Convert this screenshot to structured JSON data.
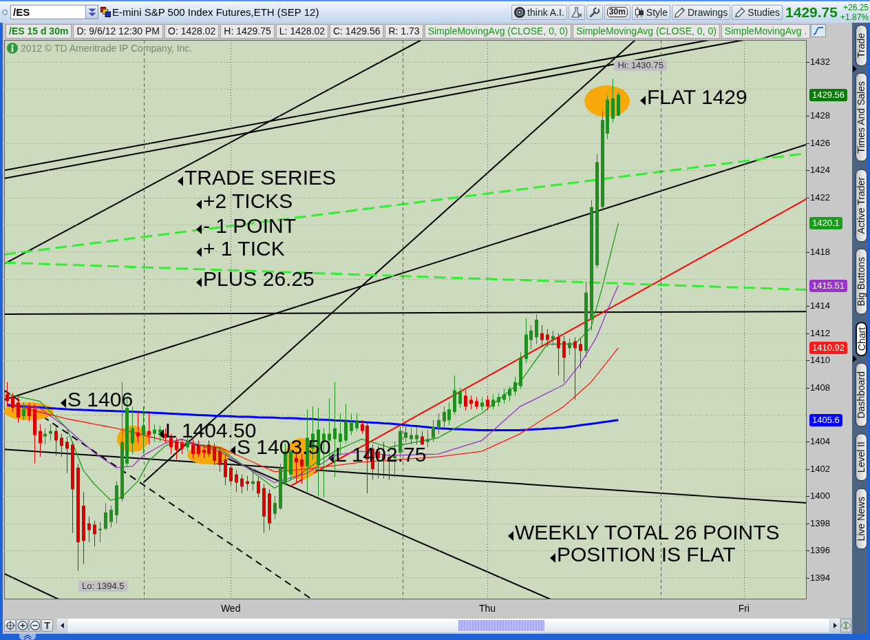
{
  "toolbar": {
    "symbol_field": {
      "value": "/ES"
    },
    "title": "E-mini S&P 500 Index Futures,ETH (SEP 12)",
    "buttons": [
      {
        "kind": "think",
        "label": "think A.I."
      },
      {
        "kind": "flask"
      },
      {
        "kind": "wrench"
      },
      {
        "kind": "interval",
        "label": "30m"
      },
      {
        "kind": "style",
        "label": "Style"
      },
      {
        "kind": "drawings",
        "label": "Drawings"
      },
      {
        "kind": "studies",
        "label": "Studies"
      }
    ],
    "last_price": "1429.75",
    "net_change": "+26.25",
    "percent_change": "+1.87%"
  },
  "legend": [
    {
      "kind": "symbol",
      "text": "/ES 15 d 30m"
    },
    {
      "kind": "readout",
      "text": "D: 9/6/12 12:30 PM"
    },
    {
      "kind": "readout",
      "text": "O: 1428.02"
    },
    {
      "kind": "readout",
      "text": "H: 1429.75"
    },
    {
      "kind": "readout",
      "text": "L: 1428.02"
    },
    {
      "kind": "readout",
      "text": "C: 1429.56"
    },
    {
      "kind": "readout",
      "text": "R: 1.73"
    },
    {
      "kind": "study",
      "text": "SimpleMovingAvg (CLOSE, 0, 0)"
    },
    {
      "kind": "study",
      "text": "SimpleMovingAvg (CLOSE, 0, 0)"
    },
    {
      "kind": "study",
      "text": "SimpleMovingAvg ."
    }
  ],
  "copyright": "2012 © TD Ameritrade IP Company, Inc.",
  "chart": {
    "chart_data": {
      "type": "candlestick",
      "categories": [
        null,
        null,
        null,
        null,
        null,
        null,
        null,
        null,
        null,
        null,
        null,
        null,
        null,
        null,
        null,
        null,
        null,
        null,
        null,
        null,
        null,
        null,
        null,
        null,
        null,
        null,
        null,
        null,
        null,
        null,
        null,
        null,
        null,
        null,
        null,
        null,
        null,
        null,
        null,
        null,
        null,
        "Wed",
        null,
        null,
        null,
        null,
        null,
        null,
        null,
        null,
        null,
        null,
        null,
        null,
        null,
        null,
        null,
        null,
        null,
        null,
        null,
        null,
        null,
        null,
        null,
        null,
        null,
        null,
        null,
        null,
        null,
        null,
        null,
        null,
        null,
        null,
        null,
        null,
        null,
        null,
        null,
        null,
        null,
        null,
        null,
        null,
        null,
        null,
        "Thu",
        null,
        null,
        null,
        null,
        null,
        null,
        null,
        null,
        null,
        null,
        null,
        null,
        null,
        null,
        null,
        null,
        null,
        null,
        null,
        null,
        null,
        null,
        null,
        null,
        null,
        null,
        null,
        null,
        null,
        null,
        null,
        null,
        null,
        null,
        null,
        null,
        null,
        null,
        null,
        null,
        null,
        null,
        null,
        null,
        null,
        null,
        "Fri",
        null,
        null,
        null,
        null,
        null,
        null,
        null,
        null,
        null,
        null,
        null
      ],
      "ohlc": [
        [
          1407.5,
          1408.4,
          1406.6,
          1407.0
        ],
        [
          1407.3,
          1407.6,
          1406.2,
          1406.5
        ],
        [
          1406.9,
          1407.3,
          1405.4,
          1405.8
        ],
        [
          1405.9,
          1406.9,
          1405.6,
          1406.4
        ],
        [
          1406.5,
          1406.9,
          1405.5,
          1405.9
        ],
        [
          1406.4,
          1406.8,
          1402.4,
          1404.5
        ],
        [
          1404.8,
          1405.3,
          1402.9,
          1403.9
        ],
        [
          1404.4,
          1405.0,
          1403.8,
          1404.6
        ],
        [
          1404.6,
          1405.3,
          1404.1,
          1404.8
        ],
        [
          1404.8,
          1405.1,
          1403.0,
          1404.1
        ],
        [
          1404.3,
          1404.6,
          1402.9,
          1403.7
        ],
        [
          1404.0,
          1404.4,
          1401.7,
          1403.5
        ],
        [
          1403.8,
          1404.0,
          1397.3,
          1400.5
        ],
        [
          1402.1,
          1402.4,
          1394.5,
          1396.6
        ],
        [
          1399.3,
          1400.3,
          1395.0,
          1396.7
        ],
        [
          1398.0,
          1398.5,
          1396.6,
          1397.5
        ],
        [
          1397.9,
          1398.2,
          1396.3,
          1397.2
        ],
        [
          1397.5,
          1398.1,
          1396.6,
          1397.6
        ],
        [
          1397.6,
          1399.5,
          1397.5,
          1398.8
        ],
        [
          1398.1,
          1399.3,
          1397.7,
          1399.0
        ],
        [
          1398.6,
          1401.1,
          1398.0,
          1400.8
        ],
        [
          1399.8,
          1408.4,
          1399.6,
          1404.0
        ],
        [
          1402.4,
          1407.3,
          1402.2,
          1406.5
        ],
        [
          1403.9,
          1406.6,
          1403.1,
          1405.0
        ],
        [
          1404.7,
          1406.2,
          1403.9,
          1404.4
        ],
        [
          1404.5,
          1406.6,
          1403.1,
          1405.2
        ],
        [
          1404.8,
          1406.1,
          1403.8,
          1404.5
        ],
        [
          1404.6,
          1405.3,
          1404.0,
          1404.9
        ],
        [
          1404.7,
          1405.2,
          1404.0,
          1404.9
        ],
        [
          1404.6,
          1405.0,
          1403.9,
          1404.3
        ],
        [
          1404.3,
          1404.6,
          1403.1,
          1403.6
        ],
        [
          1404.0,
          1404.3,
          1402.7,
          1403.4
        ],
        [
          1403.9,
          1404.2,
          1403.1,
          1403.5
        ],
        [
          1403.6,
          1404.4,
          1403.3,
          1404.0
        ],
        [
          1403.8,
          1404.2,
          1402.8,
          1403.1
        ],
        [
          1403.7,
          1404.1,
          1402.9,
          1403.1
        ],
        [
          1403.4,
          1403.8,
          1402.8,
          1403.2
        ],
        [
          1403.8,
          1404.1,
          1402.9,
          1403.1
        ],
        [
          1403.6,
          1403.9,
          1402.3,
          1402.6
        ],
        [
          1403.3,
          1403.6,
          1401.8,
          1402.3
        ],
        [
          1402.7,
          1403.0,
          1400.8,
          1401.4
        ],
        [
          1402.1,
          1402.4,
          1400.8,
          1401.1
        ],
        [
          1401.6,
          1401.9,
          1400.3,
          1401.0
        ],
        [
          1401.3,
          1401.6,
          1400.2,
          1400.7
        ],
        [
          1401.1,
          1401.5,
          1400.4,
          1400.9
        ],
        [
          1400.9,
          1402.0,
          1400.4,
          1401.1
        ],
        [
          1401.1,
          1401.4,
          1399.9,
          1400.2
        ],
        [
          1400.6,
          1400.9,
          1397.3,
          1398.5
        ],
        [
          1400.2,
          1400.5,
          1397.5,
          1398.0
        ],
        [
          1398.7,
          1400.0,
          1398.3,
          1399.5
        ],
        [
          1399.1,
          1402.4,
          1399.0,
          1402.1
        ],
        [
          1401.0,
          1403.9,
          1400.8,
          1403.3
        ],
        [
          1401.6,
          1403.4,
          1401.2,
          1403.3
        ],
        [
          1402.8,
          1403.3,
          1401.0,
          1402.5
        ],
        [
          1402.7,
          1403.1,
          1400.9,
          1402.2
        ],
        [
          1402.2,
          1406.4,
          1400.3,
          1404.3
        ],
        [
          1403.5,
          1406.6,
          1402.7,
          1404.6
        ],
        [
          1402.3,
          1406.5,
          1400.0,
          1404.9
        ],
        [
          1404.0,
          1405.0,
          1399.9,
          1404.6
        ],
        [
          1404.1,
          1407.2,
          1402.9,
          1404.6
        ],
        [
          1404.2,
          1408.4,
          1401.4,
          1405.0
        ],
        [
          1404.0,
          1406.1,
          1403.1,
          1404.6
        ],
        [
          1404.1,
          1406.8,
          1403.9,
          1405.5
        ],
        [
          1404.8,
          1406.1,
          1404.5,
          1405.4
        ],
        [
          1405.0,
          1406.1,
          1404.8,
          1405.5
        ],
        [
          1405.3,
          1405.6,
          1404.6,
          1404.8
        ],
        [
          1405.2,
          1405.4,
          1400.2,
          1402.7
        ],
        [
          1403.5,
          1403.8,
          1401.2,
          1402.0
        ],
        [
          1403.3,
          1403.7,
          1401.3,
          1402.8
        ],
        [
          1403.1,
          1404.0,
          1401.3,
          1402.7
        ],
        [
          1402.9,
          1403.1,
          1401.2,
          1402.7
        ],
        [
          1402.8,
          1404.0,
          1401.4,
          1403.0
        ],
        [
          1403.2,
          1405.3,
          1402.8,
          1404.8
        ],
        [
          1404.3,
          1405.4,
          1404.0,
          1404.7
        ],
        [
          1404.2,
          1405.0,
          1403.8,
          1404.5
        ],
        [
          1404.2,
          1405.1,
          1403.8,
          1404.5
        ],
        [
          1404.4,
          1404.8,
          1403.75,
          1403.8
        ],
        [
          1404.0,
          1404.9,
          1403.6,
          1404.2
        ],
        [
          1404.3,
          1405.6,
          1404.0,
          1405.1
        ],
        [
          1405.0,
          1406.1,
          1404.6,
          1405.6
        ],
        [
          1405.5,
          1406.6,
          1405.1,
          1406.2
        ],
        [
          1405.6,
          1406.9,
          1405.2,
          1406.4
        ],
        [
          1406.2,
          1408.9,
          1406.0,
          1407.8
        ],
        [
          1406.8,
          1408.0,
          1406.5,
          1407.7
        ],
        [
          1407.4,
          1407.8,
          1406.3,
          1406.6
        ],
        [
          1407.1,
          1407.4,
          1406.4,
          1406.8
        ],
        [
          1407.0,
          1407.3,
          1406.4,
          1406.6
        ],
        [
          1406.6,
          1407.3,
          1406.3,
          1406.9
        ],
        [
          1407.1,
          1407.4,
          1406.3,
          1406.6
        ],
        [
          1406.6,
          1407.5,
          1406.4,
          1407.1
        ],
        [
          1406.9,
          1407.6,
          1406.6,
          1407.3
        ],
        [
          1407.1,
          1407.9,
          1406.8,
          1407.5
        ],
        [
          1407.4,
          1408.1,
          1407.0,
          1407.9
        ],
        [
          1407.7,
          1408.8,
          1407.4,
          1408.4
        ],
        [
          1408.1,
          1410.6,
          1407.9,
          1410.2
        ],
        [
          1410.1,
          1413.1,
          1409.8,
          1411.9
        ],
        [
          1411.5,
          1412.6,
          1410.8,
          1412.2
        ],
        [
          1411.7,
          1413.4,
          1411.2,
          1413.0
        ],
        [
          1412.0,
          1412.6,
          1411.0,
          1411.5
        ],
        [
          1411.9,
          1412.3,
          1411.0,
          1411.5
        ],
        [
          1411.5,
          1412.2,
          1411.1,
          1411.8
        ],
        [
          1411.7,
          1412.0,
          1408.9,
          1410.9
        ],
        [
          1411.4,
          1411.8,
          1408.4,
          1410.2
        ],
        [
          1410.9,
          1411.6,
          1410.4,
          1411.3
        ],
        [
          1411.4,
          1411.7,
          1407.1,
          1410.9
        ],
        [
          1411.2,
          1411.6,
          1409.4,
          1410.7
        ],
        [
          1410.7,
          1415.8,
          1410.2,
          1415.0
        ],
        [
          1413.0,
          1421.8,
          1412.2,
          1421.3
        ],
        [
          1417.0,
          1425.2,
          1416.8,
          1424.6
        ],
        [
          1421.3,
          1428.4,
          1421.0,
          1427.7
        ],
        [
          1426.7,
          1429.5,
          1426.3,
          1429.2
        ],
        [
          1427.8,
          1430.75,
          1427.5,
          1429.3
        ],
        [
          1428.02,
          1429.75,
          1428.02,
          1429.56
        ],
        null,
        null,
        null,
        null,
        null,
        null,
        null,
        null,
        null,
        null,
        null,
        null,
        null,
        null,
        null,
        null,
        null,
        null,
        null,
        null,
        null,
        null,
        null,
        null,
        null,
        null,
        null,
        null,
        null,
        null,
        null,
        null,
        null,
        null
      ],
      "ylim": [
        1392.4,
        1433.6
      ],
      "yticks": [
        1394,
        1396,
        1398,
        1400,
        1402,
        1404,
        1408,
        1410,
        1412,
        1414,
        1418,
        1422,
        1424,
        1426,
        1428,
        1432
      ],
      "grid": true,
      "series": [
        {
          "type": "line",
          "color": "#1c9c1c",
          "values": [
            1407.5,
            1407.42,
            1407.33,
            1407.25,
            1407.17,
            1407.08,
            1407.0,
            1406.6,
            1406.2,
            1405.8,
            1405.4,
            1405.0,
            1403.97,
            1402.93,
            1401.9,
            1401.4,
            1400.9,
            1400.5,
            1400.1,
            1399.7,
            1399.8,
            1399.9,
            1400.3,
            1400.7,
            1401.1,
            1401.85,
            1402.6,
            1402.97,
            1403.33,
            1403.7,
            1403.87,
            1404.03,
            1404.2,
            1404.05,
            1403.9,
            1403.82,
            1403.74,
            1403.66,
            1403.58,
            1403.5,
            1403.22,
            1402.94,
            1402.66,
            1402.38,
            1402.1,
            1401.8,
            1401.5,
            1401.2,
            1400.9,
            1400.6,
            1400.8,
            1401.0,
            1401.2,
            1401.4,
            1401.7,
            1402.0,
            1402.3,
            1402.55,
            1402.8,
            1403.05,
            1403.3,
            1403.48,
            1403.66,
            1403.84,
            1404.02,
            1404.2,
            1404.08,
            1403.96,
            1403.84,
            1403.72,
            1403.6,
            1403.68,
            1403.76,
            1403.83,
            1403.91,
            1403.99,
            1404.07,
            1404.14,
            1404.22,
            1404.3,
            1404.53,
            1404.75,
            1404.98,
            1405.2,
            1405.43,
            1405.65,
            1405.88,
            1406.1,
            1406.43,
            1406.76,
            1407.09,
            1407.41,
            1407.74,
            1408.07,
            1408.4,
            1408.96,
            1409.52,
            1410.08,
            1410.64,
            1411.2,
            1411.2,
            1411.2,
            1411.2,
            1411.2,
            1411.2,
            1411.6,
            1412.0,
            1412.4,
            1413.85,
            1415.3,
            1416.9,
            1418.5,
            1420.1,
            null,
            null,
            null,
            null,
            null,
            null,
            null,
            null,
            null,
            null,
            null,
            null,
            null,
            null,
            null,
            null,
            null,
            null,
            null,
            null,
            null,
            null,
            null,
            null,
            null,
            null,
            null,
            null,
            null,
            null,
            null,
            null,
            null,
            null
          ]
        },
        {
          "type": "line",
          "color": "#9933cc",
          "values": [
            1406.8,
            1406.75,
            1406.7,
            1406.65,
            1406.6,
            1406.55,
            1406.5,
            1406.2,
            1405.9,
            1405.6,
            1405.3,
            1405.0,
            1404.64,
            1404.28,
            1403.92,
            1403.56,
            1403.2,
            1402.93,
            1402.65,
            1402.38,
            1402.1,
            1402.13,
            1402.17,
            1402.2,
            1402.6,
            1403.0,
            1403.23,
            1403.45,
            1403.68,
            1403.9,
            1404.0,
            1404.1,
            1404.2,
            1404.05,
            1403.9,
            1403.78,
            1403.66,
            1403.54,
            1403.42,
            1403.3,
            1403.06,
            1402.82,
            1402.58,
            1402.34,
            1402.1,
            1401.88,
            1401.66,
            1401.44,
            1401.22,
            1401.0,
            1401.12,
            1401.23,
            1401.35,
            1401.47,
            1401.58,
            1401.7,
            1401.96,
            1402.22,
            1402.48,
            1402.74,
            1403.0,
            1403.06,
            1403.12,
            1403.18,
            1403.24,
            1403.3,
            1403.24,
            1403.18,
            1403.12,
            1403.06,
            1403.0,
            1403.01,
            1403.02,
            1403.03,
            1403.04,
            1403.06,
            1403.07,
            1403.08,
            1403.09,
            1403.1,
            1403.23,
            1403.35,
            1403.48,
            1403.6,
            1403.73,
            1403.85,
            1403.98,
            1404.1,
            1404.46,
            1404.81,
            1405.17,
            1405.53,
            1405.89,
            1406.24,
            1406.6,
            1406.8,
            1407.0,
            1407.2,
            1407.4,
            1407.6,
            1407.8,
            1408.0,
            1408.2,
            1408.7,
            1409.2,
            1409.7,
            1410.37,
            1411.03,
            1411.7,
            1412.7,
            1413.7,
            1414.61,
            1415.51,
            null,
            null,
            null,
            null,
            null,
            null,
            null,
            null,
            null,
            null,
            null,
            null,
            null,
            null,
            null,
            null,
            null,
            null,
            null,
            null,
            null,
            null,
            null,
            null,
            null,
            null,
            null,
            null,
            null,
            null,
            null,
            null,
            null,
            null
          ]
        },
        {
          "type": "line",
          "color": "#ff1a1a",
          "values": [
            1406.8,
            1406.7,
            1406.6,
            1406.5,
            1406.4,
            1406.3,
            1406.2,
            1406.1,
            1406.0,
            1405.9,
            1405.8,
            1405.7,
            1405.62,
            1405.54,
            1405.47,
            1405.39,
            1405.31,
            1405.23,
            1405.16,
            1405.08,
            1405.0,
            1404.9,
            1404.8,
            1404.7,
            1404.6,
            1404.5,
            1404.4,
            1404.3,
            1404.2,
            1404.1,
            1404.05,
            1404.0,
            1403.95,
            1403.9,
            1403.85,
            1403.8,
            1403.75,
            1403.7,
            1403.65,
            1403.6,
            1403.42,
            1403.24,
            1403.06,
            1402.88,
            1402.7,
            1402.52,
            1402.34,
            1402.16,
            1401.98,
            1401.8,
            1401.83,
            1401.87,
            1401.9,
            1401.93,
            1401.97,
            1402.0,
            1402.05,
            1402.1,
            1402.15,
            1402.2,
            1402.25,
            1402.3,
            1402.35,
            1402.4,
            1402.45,
            1402.5,
            1402.53,
            1402.56,
            1402.59,
            1402.61,
            1402.64,
            1402.67,
            1402.7,
            1402.73,
            1402.76,
            1402.79,
            1402.81,
            1402.84,
            1402.87,
            1402.9,
            1402.95,
            1403.0,
            1403.05,
            1403.1,
            1403.15,
            1403.2,
            1403.25,
            1403.3,
            1403.49,
            1403.67,
            1403.86,
            1404.04,
            1404.23,
            1404.41,
            1404.6,
            1404.85,
            1405.1,
            1405.35,
            1405.6,
            1405.85,
            1406.1,
            1406.35,
            1406.6,
            1406.96,
            1407.32,
            1407.68,
            1408.04,
            1408.4,
            1408.9,
            1409.41,
            1409.91,
            1410.42,
            1410.92,
            null,
            null,
            null,
            null,
            null,
            null,
            null,
            null,
            null,
            null,
            null,
            null,
            null,
            null,
            null,
            null,
            null,
            null,
            null,
            null,
            null,
            null,
            null,
            null,
            null,
            null,
            null,
            null,
            null,
            null,
            null,
            null,
            null,
            null
          ]
        },
        {
          "type": "line",
          "color": "#0000ff",
          "values": [
            1406.7,
            1406.67,
            1406.65,
            1406.62,
            1406.59,
            1406.56,
            1406.54,
            1406.51,
            1406.48,
            1406.45,
            1406.43,
            1406.4,
            1406.38,
            1406.37,
            1406.35,
            1406.34,
            1406.32,
            1406.31,
            1406.29,
            1406.28,
            1406.26,
            1406.25,
            1406.23,
            1406.22,
            1406.2,
            1406.18,
            1406.16,
            1406.14,
            1406.12,
            1406.1,
            1406.08,
            1406.06,
            1406.04,
            1406.02,
            1406.0,
            1405.98,
            1405.96,
            1405.94,
            1405.92,
            1405.9,
            1405.89,
            1405.88,
            1405.86,
            1405.85,
            1405.84,
            1405.83,
            1405.81,
            1405.8,
            1405.79,
            1405.78,
            1405.76,
            1405.75,
            1405.74,
            1405.73,
            1405.71,
            1405.7,
            1405.68,
            1405.65,
            1405.63,
            1405.61,
            1405.58,
            1405.56,
            1405.54,
            1405.51,
            1405.49,
            1405.47,
            1405.44,
            1405.42,
            1405.4,
            1405.37,
            1405.35,
            1405.31,
            1405.27,
            1405.23,
            1405.19,
            1405.16,
            1405.12,
            1405.08,
            1405.04,
            1405.0,
            1404.98,
            1404.96,
            1404.94,
            1404.93,
            1404.91,
            1404.89,
            1404.87,
            1404.85,
            1404.85,
            1404.85,
            1404.85,
            1404.85,
            1404.85,
            1404.85,
            1404.85,
            1404.88,
            1404.9,
            1404.93,
            1404.95,
            1404.98,
            1405.0,
            1405.03,
            1405.05,
            1405.11,
            1405.16,
            1405.22,
            1405.27,
            1405.33,
            1405.38,
            1405.44,
            1405.49,
            1405.55,
            1405.6,
            null,
            null,
            null,
            null,
            null,
            null,
            null,
            null,
            null,
            null,
            null,
            null,
            null,
            null,
            null,
            null,
            null,
            null,
            null,
            null,
            null,
            null,
            null,
            null,
            null,
            null,
            null,
            null,
            null,
            null,
            null,
            null,
            null,
            null
          ]
        }
      ],
      "annotations": [
        "Hi: 1430.75",
        "FLAT 1429",
        "TRADE SERIES",
        "+2 TICKS",
        "- 1 POINT",
        "+ 1 TICK",
        "PLUS 26.25",
        "S 1406",
        "L 1404.50",
        "S 1403.50",
        "L 1402.75",
        "WEEKLY TOTAL 26 POINTS",
        "POSITION IS FLAT",
        "Lo: 1394.5"
      ]
    },
    "price_bubbles": [
      {
        "text": "1429.56",
        "color": "#0b7a0b"
      },
      {
        "text": "1420.1",
        "color": "#1c9c1c"
      },
      {
        "text": "1415.51",
        "color": "#9933cc"
      },
      {
        "text": "1410.92",
        "color": "#ff1a1a"
      },
      {
        "text": "1405.6",
        "color": "#0000ff"
      }
    ]
  },
  "side_tab_groups": [
    [
      {
        "label": "Trade",
        "selected": false
      }
    ],
    [
      {
        "label": "Times And Sales",
        "selected": false
      },
      {
        "label": "Active Trader",
        "selected": false
      },
      {
        "label": "Big Buttons",
        "selected": false
      },
      {
        "label": "Chart",
        "selected": true
      }
    ],
    [
      {
        "label": "Dashboard",
        "selected": false
      },
      {
        "label": "Level II",
        "selected": false
      },
      {
        "label": "Live News",
        "selected": false
      }
    ]
  ],
  "bottom_bar": {
    "tools": [
      {
        "kind": "pan"
      },
      {
        "kind": "zoom_in"
      },
      {
        "kind": "zoom_out"
      },
      {
        "kind": "text",
        "label": "T"
      }
    ]
  }
}
